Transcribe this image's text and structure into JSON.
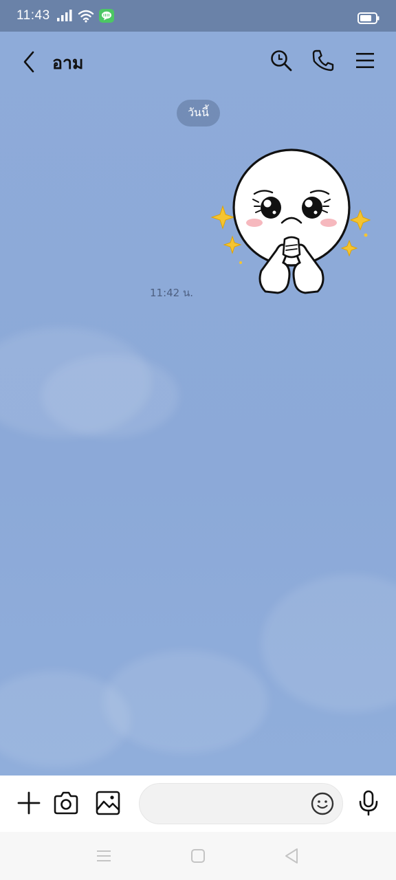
{
  "status_bar": {
    "time": "11:43",
    "icons": [
      "signal-icon",
      "wifi-icon",
      "line-app-icon",
      "battery-icon"
    ]
  },
  "header": {
    "title": "อาม",
    "icons": [
      "back-icon",
      "search-icon",
      "phone-icon",
      "menu-icon"
    ]
  },
  "chat": {
    "date_separator": "วันนี้",
    "messages": [
      {
        "type": "sticker",
        "sticker_name": "moon-pleading-sticker",
        "time": "11:42 น."
      }
    ]
  },
  "input_bar": {
    "icons": [
      "plus-icon",
      "camera-icon",
      "image-icon",
      "emoji-icon",
      "microphone-icon"
    ],
    "input_value": "",
    "placeholder": ""
  },
  "nav_bar": {
    "icons": [
      "recents-icon",
      "home-icon",
      "back-triangle-icon"
    ]
  },
  "colors": {
    "chat_background": "#8eabd9",
    "status_bar": "#6a82a8",
    "line_green": "#4cc764",
    "date_pill": "#6e87af"
  }
}
